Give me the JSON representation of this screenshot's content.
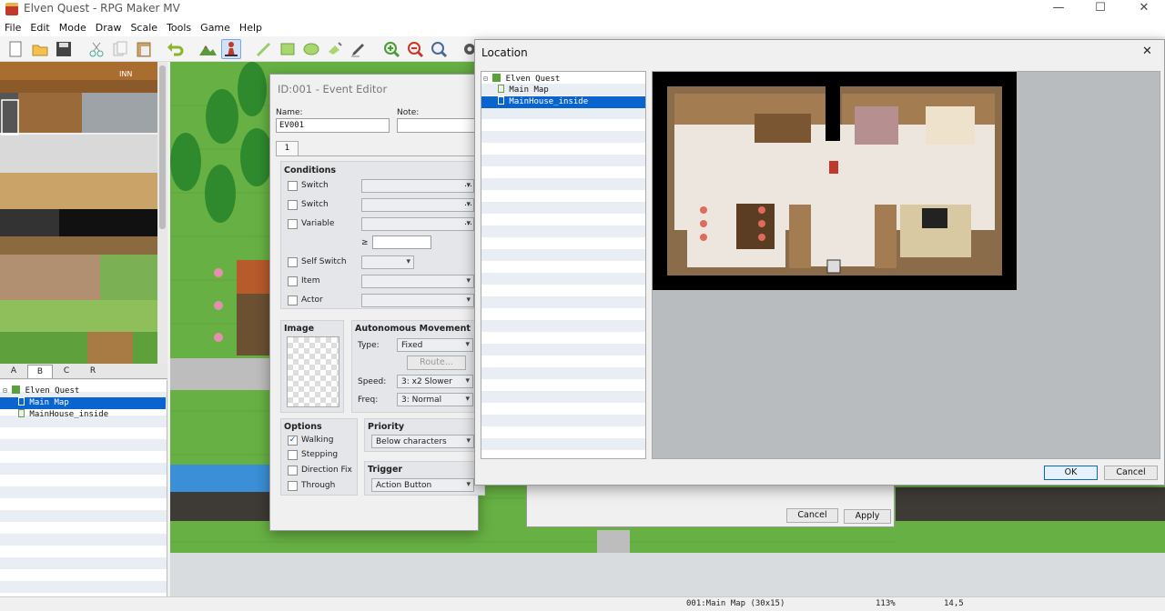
{
  "app": {
    "title": "Elven Quest - RPG Maker MV"
  },
  "window_controls": {
    "minimize": "—",
    "maximize": "☐",
    "close": "✕"
  },
  "menu": [
    "File",
    "Edit",
    "Mode",
    "Draw",
    "Scale",
    "Tools",
    "Game",
    "Help"
  ],
  "toolbar_icons": [
    "new-project",
    "open-project",
    "save-project",
    "cut",
    "copy",
    "paste",
    "undo",
    "map-mode",
    "event-mode",
    "pencil-tool",
    "rectangle-tool",
    "ellipse-tool",
    "fill-tool",
    "shadow-pen",
    "zoom-in",
    "zoom-out",
    "actual-size",
    "database"
  ],
  "tile_tabs": [
    "A",
    "B",
    "C",
    "R"
  ],
  "map_tree": {
    "root": "Elven Quest",
    "items": [
      "Main Map",
      "MainHouse_inside"
    ],
    "selected": "Main Map"
  },
  "event_editor": {
    "title": "ID:001 - Event Editor",
    "name_label": "Name:",
    "name_value": "EV001",
    "note_label": "Note:",
    "page_tab": "1",
    "conditions": {
      "header": "Conditions",
      "rows": [
        "Switch",
        "Switch",
        "Variable",
        "Self Switch",
        "Item",
        "Actor"
      ],
      "ge": "≥",
      "ellipsis": "…"
    },
    "image_header": "Image",
    "movement": {
      "header": "Autonomous Movement",
      "type_label": "Type:",
      "type_value": "Fixed",
      "route_button": "Route...",
      "speed_label": "Speed:",
      "speed_value": "3: x2 Slower",
      "freq_label": "Freq:",
      "freq_value": "3: Normal"
    },
    "options": {
      "header": "Options",
      "items": [
        {
          "label": "Walking",
          "checked": true,
          "mark": "✓"
        },
        {
          "label": "Stepping",
          "checked": false
        },
        {
          "label": "Direction Fix",
          "checked": false
        },
        {
          "label": "Through",
          "checked": false
        }
      ]
    },
    "priority": {
      "header": "Priority",
      "value": "Below characters"
    },
    "trigger": {
      "header": "Trigger",
      "value": "Action Button"
    },
    "cancel": "Cancel",
    "apply": "Apply"
  },
  "location_dialog": {
    "title": "Location",
    "close": "✕",
    "tree": {
      "root": "Elven Quest",
      "items": [
        "Main Map",
        "MainHouse_inside"
      ],
      "selected": "MainHouse_inside"
    },
    "ok": "OK",
    "cancel": "Cancel"
  },
  "status": {
    "map": "001:Main Map (30x15)",
    "zoom": "113%",
    "coords": "14,5"
  },
  "colors": {
    "selection": "#0a64d0",
    "grass": "#67b144",
    "water": "#3b8fd6"
  }
}
